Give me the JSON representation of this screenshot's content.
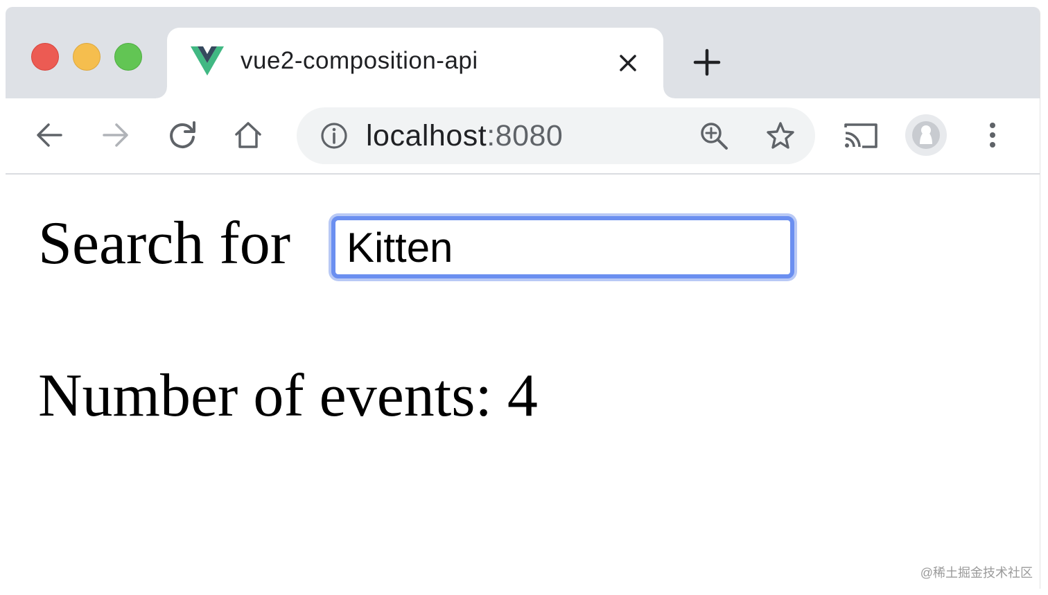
{
  "browser": {
    "tab": {
      "title": "vue2-composition-api",
      "favicon": "vue-logo-icon"
    },
    "address_bar": {
      "host": "localhost",
      "port": ":8080",
      "security_icon": "info-icon"
    },
    "toolbar_icons": [
      "back-arrow-icon",
      "forward-arrow-icon",
      "reload-icon",
      "home-icon",
      "zoom-icon",
      "star-icon",
      "cast-icon",
      "profile-icon",
      "more-menu-icon"
    ]
  },
  "page": {
    "search_label": "Search for",
    "search_value": "Kitten",
    "events_text": "Number of events: 4"
  },
  "watermark": "@稀土掘金技术社区",
  "colors": {
    "tabstrip": "#dee1e6",
    "focus_ring": "#6b8ff0",
    "vue_green": "#41b883",
    "vue_dark": "#35495e"
  }
}
